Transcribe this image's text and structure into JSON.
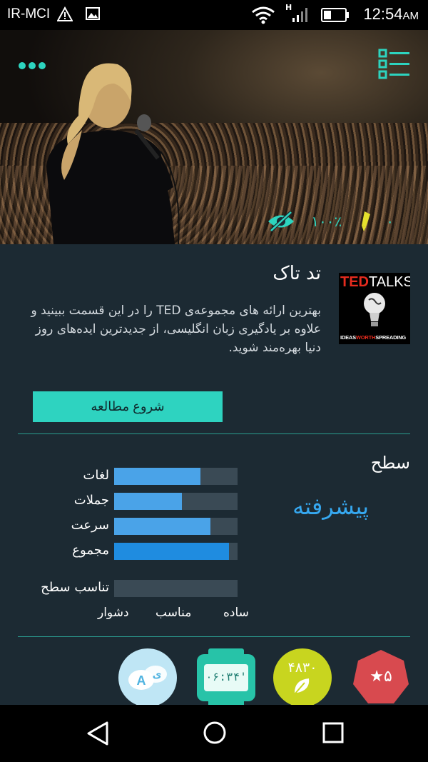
{
  "status_bar": {
    "carrier": "IR-MCI",
    "time": "12:54",
    "am_pm": "AM",
    "network": "H",
    "icons": [
      "warning-icon",
      "image-icon",
      "wifi-icon",
      "signal-icon",
      "battery-icon"
    ]
  },
  "hero": {
    "icons": [
      "more-dots-icon",
      "list-menu-icon",
      "eye-off-icon",
      "highlighter-icon"
    ],
    "completion": "۱۰۰٪",
    "highlights": "۰"
  },
  "course": {
    "title": "تد تاک",
    "description": "بهترین ارائه های مجموعه‌ی TED را در این قسمت ببینید و علاوه بر یادگیری زبان انگلیسی، از جدیدترین ایده‌های روز دنیا بهره‌مند شوید.",
    "logo": {
      "brand_red": "TED",
      "brand_white": "TALKS",
      "tagline_1": "IDEAS",
      "tagline_2": "WORTH",
      "tagline_3": "SPREADING"
    },
    "start_button": "شروع مطالعه"
  },
  "level": {
    "heading": "سطح",
    "value": "پیشرفته",
    "bars": [
      {
        "label": "لغات",
        "value": 0.7,
        "color": "#4aa3e8"
      },
      {
        "label": "جملات",
        "value": 0.55,
        "color": "#4aa3e8"
      },
      {
        "label": "سرعت",
        "value": 0.78,
        "color": "#4aa3e8"
      },
      {
        "label": "مجموع",
        "value": 0.93,
        "color": "#1f8ce0"
      },
      {
        "label": "تناسب سطح",
        "value": 0.0,
        "color": "#4aa3e8"
      }
    ],
    "scale": [
      "ساده",
      "مناسب",
      "دشوار"
    ]
  },
  "badges": {
    "stars": "۵",
    "points": "۴۸۳۰",
    "timer": "۰۶:۳۴'",
    "colors": {
      "stars": "#d84a4f",
      "points": "#c8d51f",
      "timer": "#27c3a8",
      "lang": "#bfe6f5"
    }
  },
  "colors": {
    "accent": "#2ed3c0",
    "background": "#1c2a33",
    "level": "#36a8f0"
  }
}
